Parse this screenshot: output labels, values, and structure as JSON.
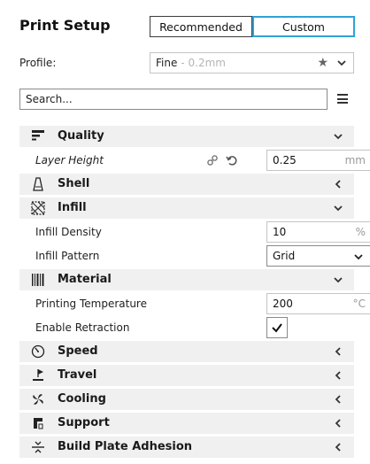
{
  "header": {
    "title": "Print Setup",
    "mode_recommended": "Recommended",
    "mode_custom": "Custom"
  },
  "profile": {
    "label": "Profile:",
    "name": "Fine",
    "detail": "- 0.2mm"
  },
  "search": {
    "value": "Search..."
  },
  "categories": {
    "quality": "Quality",
    "shell": "Shell",
    "infill": "Infill",
    "material": "Material",
    "speed": "Speed",
    "travel": "Travel",
    "cooling": "Cooling",
    "support": "Support",
    "adhesion": "Build Plate Adhesion"
  },
  "settings": {
    "layer_height": {
      "label": "Layer Height",
      "value": "0.25",
      "unit": "mm"
    },
    "infill_density": {
      "label": "Infill Density",
      "value": "10",
      "unit": "%"
    },
    "infill_pattern": {
      "label": "Infill Pattern",
      "value": "Grid"
    },
    "print_temperature": {
      "label": "Printing Temperature",
      "value": "200",
      "unit": "°C"
    },
    "enable_retraction": {
      "label": "Enable Retraction",
      "checked": true
    }
  },
  "icons": {
    "star": "star-icon",
    "link": "link-icon",
    "reset": "reset-icon",
    "menu": "hamburger-menu-icon"
  },
  "colors": {
    "accent": "#30a2d8",
    "category_bg": "#f0f0f0",
    "border": "#c4c4c4"
  }
}
